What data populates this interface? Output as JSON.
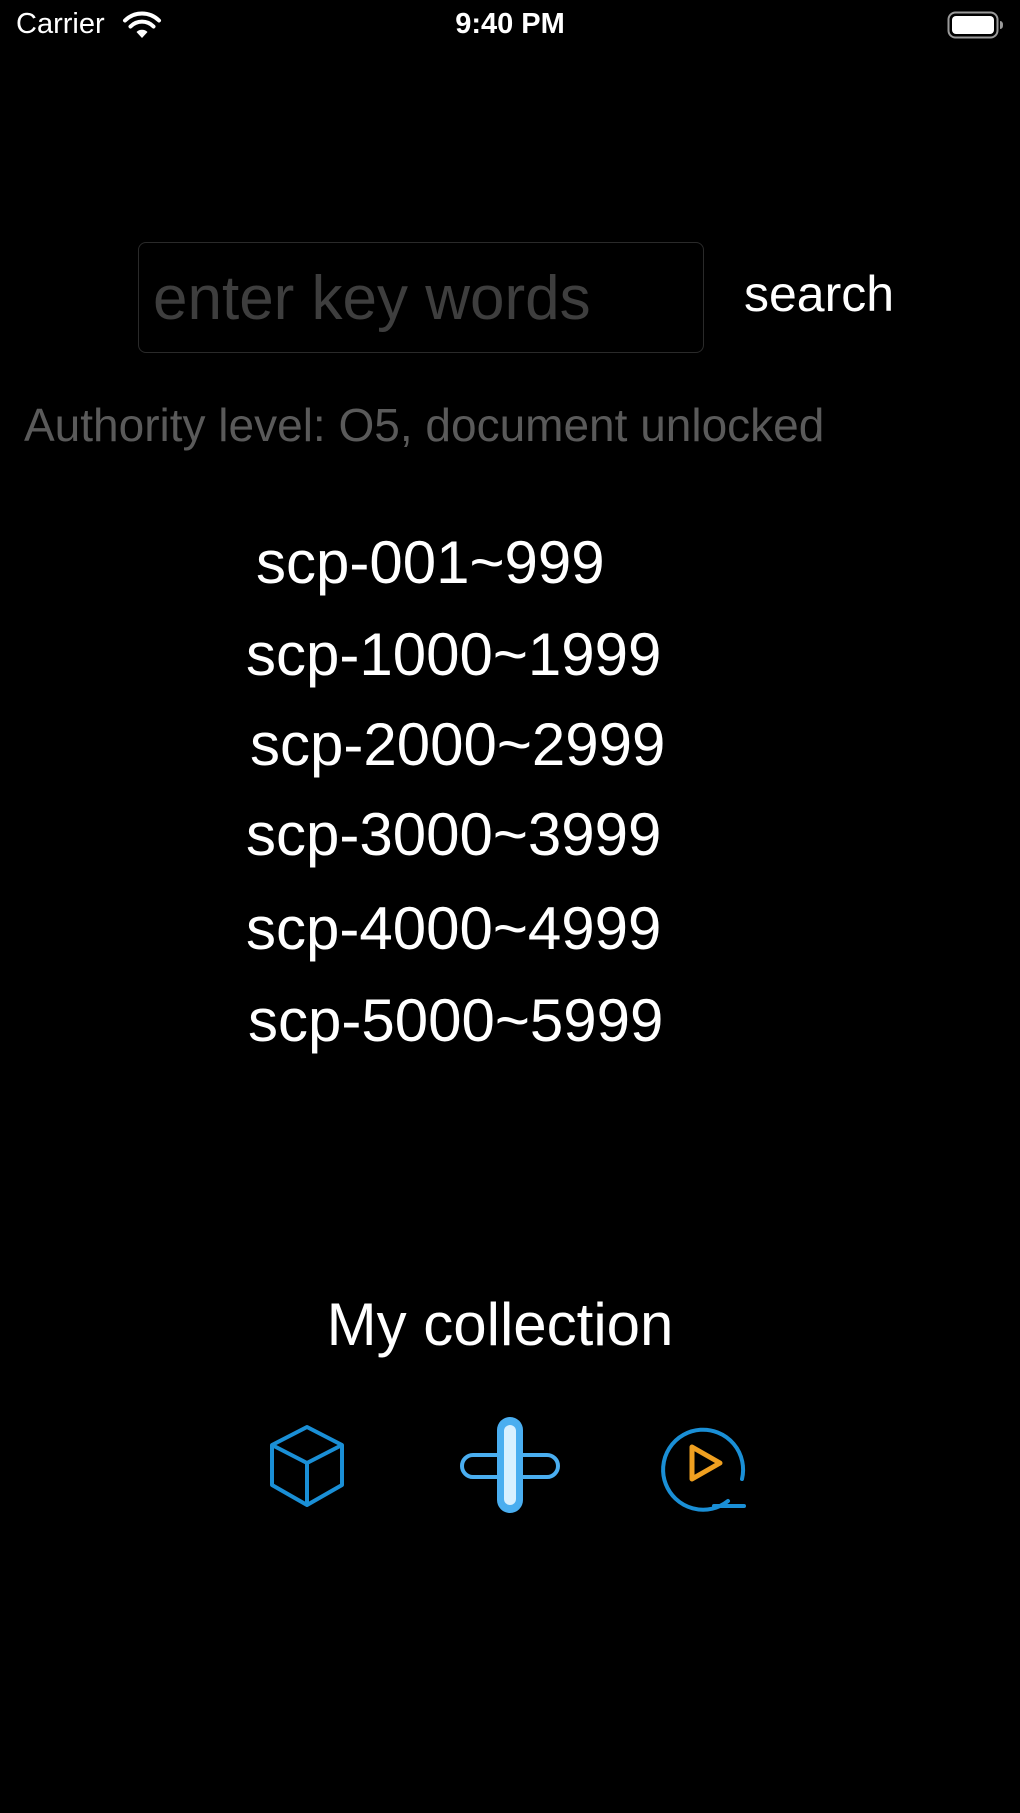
{
  "status_bar": {
    "carrier": "Carrier",
    "time": "9:40 PM",
    "wifi_icon": "wifi-icon",
    "battery_icon": "battery-full-icon"
  },
  "search": {
    "placeholder": "enter key words",
    "value": "",
    "button_label": "search"
  },
  "authority_text": "Authority level: O5, document unlocked",
  "ranges": [
    {
      "label": "scp-001~999"
    },
    {
      "label": "scp-1000~1999"
    },
    {
      "label": "scp-2000~2999"
    },
    {
      "label": "scp-3000~3999"
    },
    {
      "label": "scp-4000~4999"
    },
    {
      "label": "scp-5000~5999"
    }
  ],
  "collection": {
    "title": "My collection",
    "icons": [
      {
        "name": "cube-icon",
        "color": "#1a8fd6"
      },
      {
        "name": "plus-icon",
        "color": "#4aaef0"
      },
      {
        "name": "play-circle-icon",
        "color": "#1a8fd6",
        "accent": "#f0a020"
      }
    ]
  }
}
